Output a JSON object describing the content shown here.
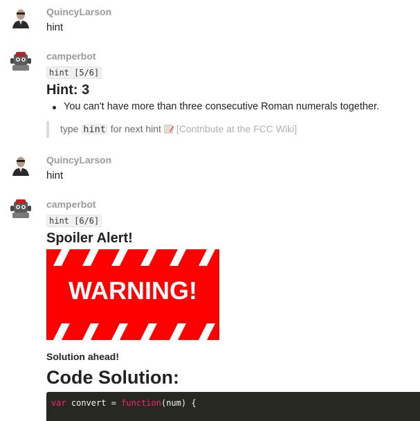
{
  "messages": [
    {
      "username": "QuincyLarson",
      "text": "hint"
    },
    {
      "username": "camperbot",
      "code_tag": "hint [5/6]",
      "heading": "Hint: 3",
      "bullet": "You can't have more than three consecutive Roman numerals together.",
      "quote": {
        "prefix": "type",
        "code": "hint",
        "suffix": "for next hint",
        "link": "[Contribute at the FCC Wiki]"
      }
    },
    {
      "username": "QuincyLarson",
      "text": "hint"
    },
    {
      "username": "camperbot",
      "code_tag": "hint [6/6]",
      "heading": "Spoiler Alert!",
      "warning_image_text": "WARNING!",
      "solution_ahead": "Solution ahead!",
      "code_heading": "Code Solution:",
      "code": {
        "keyword1": "var",
        "part1": " convert = ",
        "keyword2": "function",
        "part2": "(num) {"
      }
    }
  ],
  "colors": {
    "warning_red": "#ff0000",
    "code_bg": "#272822",
    "keyword": "#f92672",
    "username": "#9a9a9a"
  }
}
